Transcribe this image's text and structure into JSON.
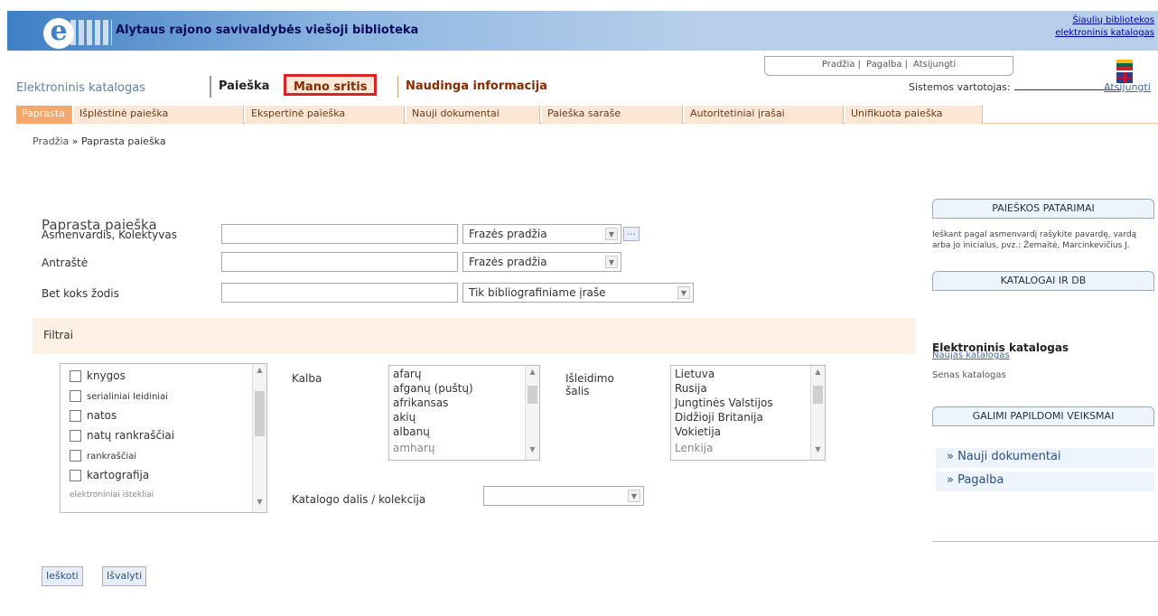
{
  "banner": {
    "title": "Alytaus rajono savivaldybės viešoji biblioteka",
    "links": [
      "Šiaulių bibliotekos",
      "elektroninis katalogas"
    ]
  },
  "topnav": {
    "brand": "Elektroninis katalogas",
    "tabs": [
      "Paieška",
      "Mano sritis",
      "Naudinga informacija"
    ],
    "utility": [
      "Pradžia",
      "Pagalba",
      "Atsijungti"
    ],
    "session_label": "Sistemos vartotojas:",
    "login": "Atsijungti"
  },
  "subnav": [
    "Paprasta",
    "Išplėstinė paieška",
    "Ekspertinė paieška",
    "Nauji dokumentai",
    "Paieška saraše",
    "Autoritetiniai įrašai",
    "Unifikuota paieška"
  ],
  "breadcrumb": {
    "home": "Pradžia",
    "sep": " » ",
    "current": "Paprasta paieška"
  },
  "form": {
    "title": "Paprasta paieška",
    "fields": [
      {
        "label": "Asmenvardis, Kolektyvas",
        "select": "Frazės pradžia"
      },
      {
        "label": "Antraštė",
        "select": "Frazės pradžia"
      },
      {
        "label": "Bet koks žodis",
        "select": "Tik bibliografiniame įraše"
      }
    ],
    "dots": "..."
  },
  "filter": {
    "title": "Filtrai",
    "doc_types": [
      "knygos",
      "serialiniai leidiniai",
      "natos",
      "natų rankraščiai",
      "rankraščiai",
      "kartografija",
      "elektroniniai ištekliai"
    ],
    "lang_label": "Kalba",
    "languages": [
      "afarų",
      "afganų (puštų)",
      "afrikansas",
      "akių",
      "albanų",
      "amharų"
    ],
    "country_label": [
      "Išleidimo",
      "šalis"
    ],
    "countries": [
      "Lietuva",
      "Rusija",
      "Jungtinės Valstijos",
      "Didžioji Britanija",
      "Vokietija",
      "Lenkija"
    ],
    "collection_label": "Katalogo dalis / kolekcija"
  },
  "buttons": {
    "search": "Ieškoti",
    "clear": "Išvalyti"
  },
  "sidebar": {
    "search_tips_title": "PAIEŠKOS PATARIMAI",
    "tips_text": "Ieškant pagal asmenvardį rašykite pavardę, vardą arba jo inicialus, pvz.: Žemaitė, Marcinkevičius J.",
    "catalog_title": "KATALOGAI IR DB",
    "catalog_name": "Elektroninis katalogas",
    "catalog_link": "Naujas katalogas",
    "catalog_plain": "Senas katalogas",
    "extra_title": "GALIMI PAPILDOMI VEIKSMAI",
    "nav": [
      "» Nauji dokumentai",
      "» Pagalba"
    ]
  }
}
